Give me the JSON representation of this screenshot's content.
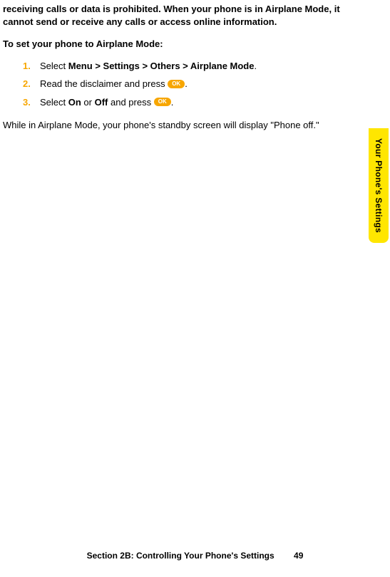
{
  "intro_text": "receiving calls or data is prohibited. When your phone is in Airplane Mode, it cannot send or receive any calls or access online information.",
  "heading": "To set your phone to Airplane Mode:",
  "steps": {
    "s1": {
      "num": "1.",
      "prefix": "Select ",
      "menu": "Menu",
      "gt1": " > ",
      "settings": "Settings",
      "gt2": " > ",
      "others": "Others",
      "gt3": " > ",
      "airplane": "Airplane Mode",
      "period": "."
    },
    "s2": {
      "num": "2.",
      "prefix": "Read the disclaimer and press ",
      "ok": "OK",
      "period": "."
    },
    "s3": {
      "num": "3.",
      "prefix": "Select ",
      "on": "On",
      "or": " or ",
      "off": "Off",
      "press": " and press ",
      "ok": "OK",
      "period": "."
    }
  },
  "closing_text": "While in Airplane Mode, your phone's standby screen will display \"Phone off.\"",
  "side_tab": "Your Phone's Settings",
  "footer": {
    "section": "Section 2B: Controlling Your Phone's Settings",
    "page": "49"
  }
}
